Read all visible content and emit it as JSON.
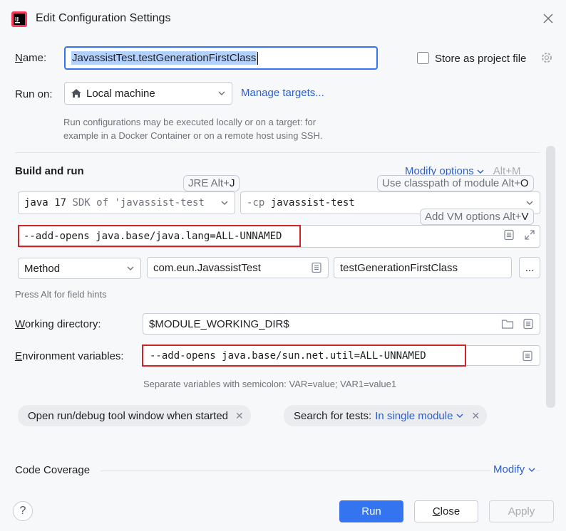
{
  "window": {
    "title": "Edit Configuration Settings"
  },
  "name": {
    "label": "Name:",
    "value": "JavassistTest.testGenerationFirstClass"
  },
  "store": {
    "label": "Store as project file",
    "checked": false
  },
  "run_on": {
    "label": "Run on:",
    "value": "Local machine",
    "manage_link": "Manage targets...",
    "hint_line1": "Run configurations may be executed locally or on a target: for",
    "hint_line2": "example in a Docker Container or on a remote host using SSH."
  },
  "build_run": {
    "title": "Build and run",
    "modify_options": "Modify options",
    "modify_shortcut": "Alt+M",
    "jre_value": "java 17",
    "jre_sdk": "SDK of 'javassist-test",
    "cp_prefix": "-cp",
    "cp_value": "javassist-test",
    "vm_options": "--add-opens java.base/java.lang=ALL-UNNAMED",
    "method_kind": "Method",
    "class_value": "com.eun.JavassistTest",
    "method_value": "testGenerationFirstClass",
    "more_button": "...",
    "field_hint": "Press Alt for field hints"
  },
  "tooltips": {
    "jre_text": "JRE Alt+",
    "jre_key": "J",
    "cp_text": "Use classpath of module Alt+",
    "cp_key": "O",
    "vm_text": "Add VM options Alt+",
    "vm_key": "V"
  },
  "working_dir": {
    "label": "Working directory:",
    "value": "$MODULE_WORKING_DIR$"
  },
  "env": {
    "label": "Environment variables:",
    "value": "--add-opens java.base/sun.net.util=ALL-UNNAMED",
    "hint": "Separate variables with semicolon: VAR=value; VAR1=value1"
  },
  "chips": {
    "open_tool": "Open run/debug tool window when started",
    "search_label": "Search for tests:",
    "search_value": "In single module"
  },
  "coverage": {
    "title": "Code Coverage",
    "modify": "Modify"
  },
  "buttons": {
    "help": "?",
    "run": "Run",
    "close": "Close",
    "apply": "Apply"
  },
  "colors": {
    "accent": "#3574f0",
    "link": "#2c5ecd",
    "highlight": "#d0242b"
  }
}
